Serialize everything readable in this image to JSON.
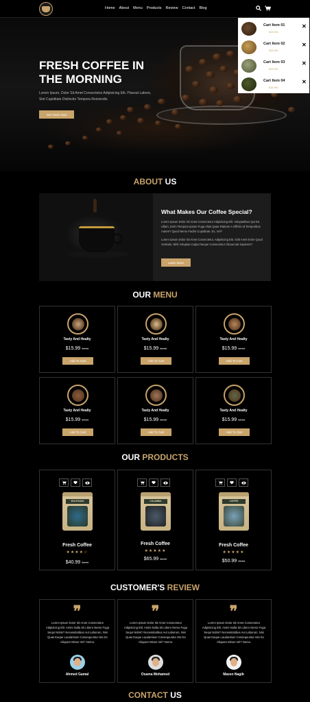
{
  "nav": {
    "items": [
      "Home",
      "About",
      "Menu",
      "Products",
      "Review",
      "Contact",
      "Blog"
    ]
  },
  "icons": {
    "search": "search-icon",
    "cart": "cart-icon",
    "close": "close-icon"
  },
  "colors": {
    "accent": "#c9a46b",
    "background": "#000000",
    "card_border": "#333333"
  },
  "cart": {
    "items": [
      {
        "name": "Cart Item 01",
        "price": "$15.99/-"
      },
      {
        "name": "Cart Item 02",
        "price": "$15.99/-"
      },
      {
        "name": "Cart Item 03",
        "price": "$15.99/-"
      },
      {
        "name": "Cart Item 04",
        "price": "$15.99/-"
      }
    ]
  },
  "hero": {
    "title": "FRESH COFFEE IN THE MORNING",
    "text": "Lorem Ipsum, Dolor Sit Amet Consectetur Adipisicing Elit. Placeat Labore, Sint Cupiditate Distinctio Tempora Reiciendis.",
    "button": "Get Yours Now"
  },
  "about": {
    "heading_main": "ABOUT",
    "heading_accent": " US",
    "title": "What Makes Our Coffee Special?",
    "p1": "Lorem Ipsum Dolor Sit Amet Consectetur Adipisicing Elit. Voluptatibus Qui Ea Ullam, Enim Tempora Ipsum Fuga Alias Quae Ratione A Officiis Id Temporibus Autem? Quod Nemo Facilis Cupiditate. Ex, Vel?",
    "p2": "Lorem Ipsum Dolor Sit Amet Consectetur, Adipisicing Elit. Odit Amet Enim Quod Veritatis, Nihil Voluptas Culpa! Neque Consectetur Obcaecati Sapiente?",
    "button": "Learn More"
  },
  "menu": {
    "heading_main": "OUR",
    "heading_accent": " MENU",
    "items": [
      {
        "name": "Tasty And Healty",
        "price": "$15.99",
        "old": "20.99",
        "button": "Add To Cart"
      },
      {
        "name": "Tasty And Healty",
        "price": "$15.99",
        "old": "20.99",
        "button": "Add To Cart"
      },
      {
        "name": "Tasty And Healty",
        "price": "$15.99",
        "old": "20.99",
        "button": "Add To Cart"
      },
      {
        "name": "Tasty And Healty",
        "price": "$15.99",
        "old": "20.99",
        "button": "Add To Cart"
      },
      {
        "name": "Tasty And Healty",
        "price": "$15.99",
        "old": "20.99",
        "button": "Add To Cart"
      },
      {
        "name": "Tasty And Healty",
        "price": "$15.99",
        "old": "20.99",
        "button": "Add To Cart"
      }
    ]
  },
  "products": {
    "heading_main": "OUR",
    "heading_accent": " PRODUCTS",
    "items": [
      {
        "name": "Fresh Coffee",
        "rating": 4,
        "price": "$40.99",
        "old": "55.99",
        "label": "WOLFGANG"
      },
      {
        "name": "Fresh Coffee",
        "rating": 5,
        "price": "$65.99",
        "old": "80.99",
        "label": "COLUMBIA"
      },
      {
        "name": "Fresh Coffee",
        "rating": 4.5,
        "price": "$50.99",
        "old": "70.99",
        "label": "COFFEE"
      }
    ]
  },
  "reviews": {
    "heading_main": "CUSTOMER'S",
    "heading_accent": " REVIEW",
    "items": [
      {
        "text": "Lorem Ipsum Dolor Sit Amet Consectetur Adipisicing Elit. Animi Nulla Sit Libero Nemo Fuga Sequi Nobis? Necessitatibus Aut Laborum, Nisi Quas Eaque Laudantium Consequuntur Iste Ex Aliquam Minus Vel? Nemo.",
        "name": "Ahmed Gamal"
      },
      {
        "text": "Lorem Ipsum Dolor Sit Amet Consectetur Adipisicing Elit. Animi Nulla Sit Libero Nemo Fuga Sequi Nobis? Necessitatibus Aut Laborum, Nisi Quas Eaque Laudantium Consequuntur Iste Ex Aliquam Minus Vel? Nemo.",
        "name": "Osama Mohamed"
      },
      {
        "text": "Lorem Ipsum Dolor Sit Amet Consectetur Adipisicing Elit. Animi Nulla Sit Libero Nemo Fuga Sequi Nobis? Necessitatibus Aut Laborum, Nisi Quas Eaque Laudantium Consequuntur Iste Ex Aliquam Minus Vel? Nemo.",
        "name": "Mazen Nagib"
      }
    ]
  },
  "contact": {
    "heading_main": "CONTACT",
    "heading_accent": " US"
  }
}
